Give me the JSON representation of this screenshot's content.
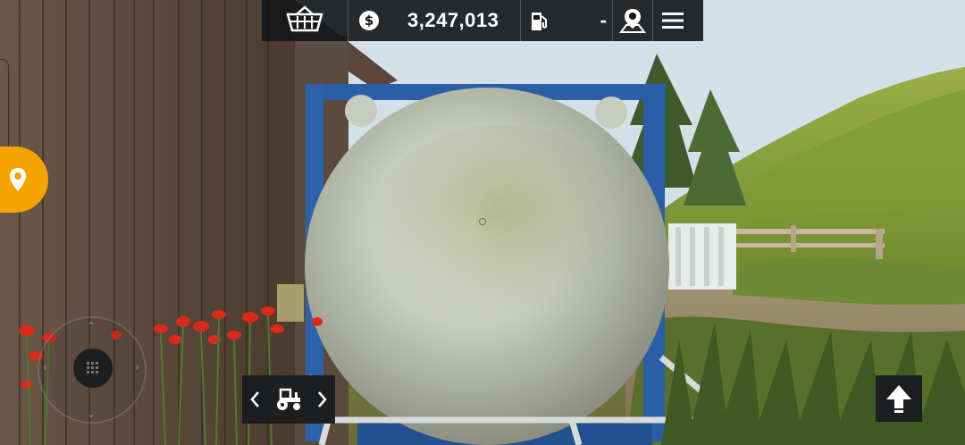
{
  "hud": {
    "money_symbol": "$",
    "money": "3,247,013",
    "fuel": "-"
  },
  "icons": {
    "shop": "basket-icon",
    "money": "dollar-coin-icon",
    "fuel": "fuel-pump-icon",
    "map_pin": "person-pin-icon",
    "menu": "hamburger-menu-icon",
    "side_map": "location-pin-icon",
    "vehicle": "tractor-icon",
    "prev": "chevron-left-icon",
    "next": "chevron-right-icon",
    "up": "arrow-up-icon",
    "joystick": "joystick-knob-icon"
  },
  "colors": {
    "hud_bg": "#141618",
    "accent_orange": "#f5a300",
    "button_bg": "#1c1e20",
    "tank_frame_blue": "#2a5fa8"
  }
}
